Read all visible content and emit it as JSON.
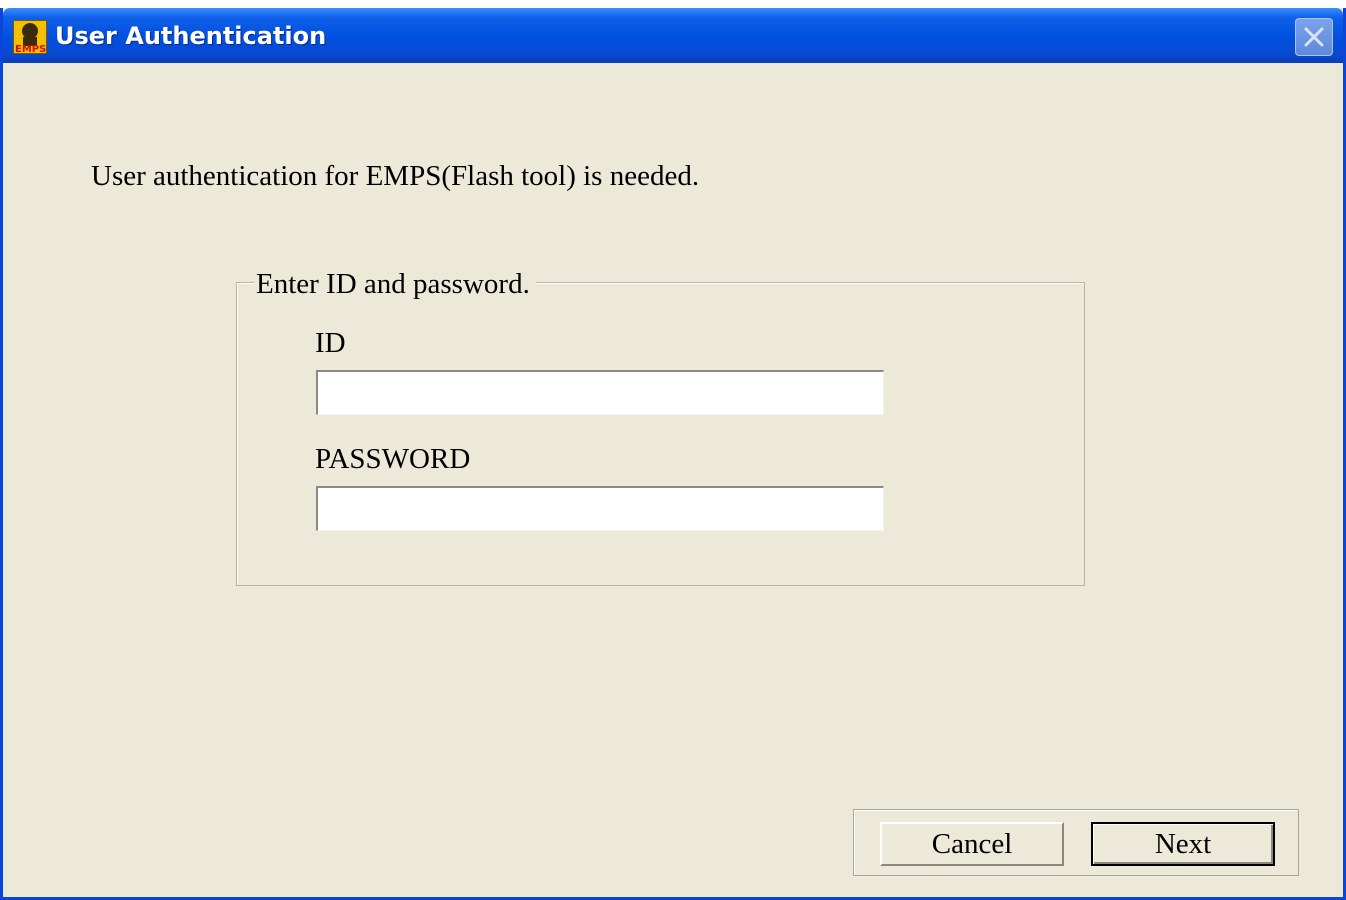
{
  "window": {
    "title": "User Authentication",
    "app_icon": "emps-icon",
    "close_icon": "close-icon"
  },
  "dialog": {
    "intro_text": "User authentication for EMPS(Flash tool) is needed.",
    "group_title": "Enter ID and password.",
    "id_label": "ID",
    "id_value": "",
    "password_label": "PASSWORD",
    "password_value": ""
  },
  "buttons": {
    "cancel_label": "Cancel",
    "next_label": "Next"
  },
  "colors": {
    "titlebar": "#0050e0",
    "dialog_background": "#ece9d8"
  }
}
